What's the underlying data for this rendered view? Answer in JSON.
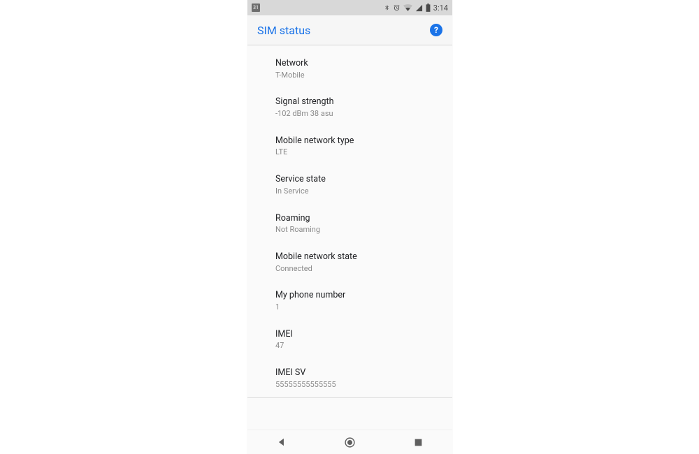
{
  "status_bar": {
    "calendar_day": "31",
    "clock": "3:14"
  },
  "app_bar": {
    "title": "SIM status",
    "help_glyph": "?"
  },
  "rows": [
    {
      "label": "Network",
      "value": "T-Mobile"
    },
    {
      "label": "Signal strength",
      "value": "-102 dBm 38 asu"
    },
    {
      "label": "Mobile network type",
      "value": "LTE"
    },
    {
      "label": "Service state",
      "value": "In Service"
    },
    {
      "label": "Roaming",
      "value": "Not Roaming"
    },
    {
      "label": "Mobile network state",
      "value": "Connected"
    },
    {
      "label": "My phone number",
      "value": "1"
    },
    {
      "label": "IMEI",
      "value": "47"
    },
    {
      "label": "IMEI SV",
      "value": "55555555555555"
    }
  ]
}
